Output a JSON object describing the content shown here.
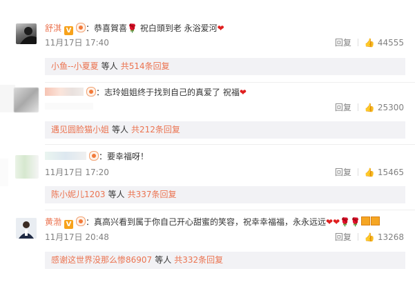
{
  "comments": [
    {
      "username": "舒淇",
      "verified": "V",
      "text": "恭喜賀喜",
      "text2": "祝白頭到老 永浴爱河",
      "date": "11月17日 17:40",
      "reply_label": "回复",
      "likes": "44555",
      "replies": {
        "who": "小鱼--小夏夏",
        "etc": "等人",
        "count": "共514条回复"
      }
    },
    {
      "username": "",
      "text": "志玲姐姐终于找到自己的真爱了 祝福",
      "date": "",
      "reply_label": "回复",
      "likes": "25300",
      "replies": {
        "who": "遇见圆脸猫小姐",
        "etc": "等人",
        "count": "共212条回复"
      }
    },
    {
      "username": "",
      "text": "要幸福呀！",
      "date": "11月17日 17:20",
      "reply_label": "回复",
      "likes": "15465",
      "replies": {
        "who": "陈小妮儿1203",
        "etc": "等人",
        "count": "共337条回复"
      }
    },
    {
      "username": "黄渤",
      "verified": "V",
      "text": "真高兴看到属于你自己开心甜蜜的笑容，祝幸幸福福，永永远远",
      "date": "11月17日 20:48",
      "reply_label": "回复",
      "likes": "13268",
      "replies": {
        "who": "感谢这世界没那么惨86907",
        "etc": "等人",
        "count": "共332条回复"
      }
    }
  ],
  "colors": {
    "username": "#eb7350",
    "meta": "#808080",
    "reply_bg": "#f2f2f5"
  }
}
